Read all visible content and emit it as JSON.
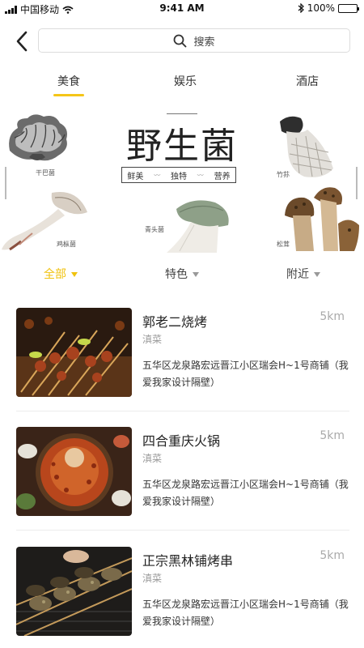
{
  "status_bar": {
    "carrier": "中国移动",
    "time": "9:41 AM",
    "battery": "100%",
    "battery_level": 1.0
  },
  "search": {
    "placeholder": "搜索"
  },
  "category_tabs": [
    {
      "label": "美食",
      "active": true
    },
    {
      "label": "娱乐",
      "active": false
    },
    {
      "label": "酒店",
      "active": false
    }
  ],
  "banner": {
    "title": "野生菌",
    "tags": [
      "鲜美",
      "独特",
      "营养"
    ],
    "mushrooms": [
      {
        "label": "干巴菌"
      },
      {
        "label": "竹荪"
      },
      {
        "label": "鸡枞菌"
      },
      {
        "label": "青头菌"
      },
      {
        "label": "松茸"
      }
    ]
  },
  "filters": [
    {
      "label": "全部",
      "active": true
    },
    {
      "label": "特色",
      "active": false
    },
    {
      "label": "附近",
      "active": false
    }
  ],
  "listings": [
    {
      "name": "郭老二烧烤",
      "distance": "5km",
      "category": "滇菜",
      "address": "五华区龙泉路宏远晋江小区瑞会H~1号商铺（我爱我家设计隔壁）"
    },
    {
      "name": "四合重庆火锅",
      "distance": "5km",
      "category": "滇菜",
      "address": "五华区龙泉路宏远晋江小区瑞会H~1号商铺（我爱我家设计隔壁）"
    },
    {
      "name": "正宗黑林铺烤串",
      "distance": "5km",
      "category": "滇菜",
      "address": "五华区龙泉路宏远晋江小区瑞会H~1号商铺（我爱我家设计隔壁）"
    }
  ],
  "colors": {
    "accent": "#f5c518"
  }
}
